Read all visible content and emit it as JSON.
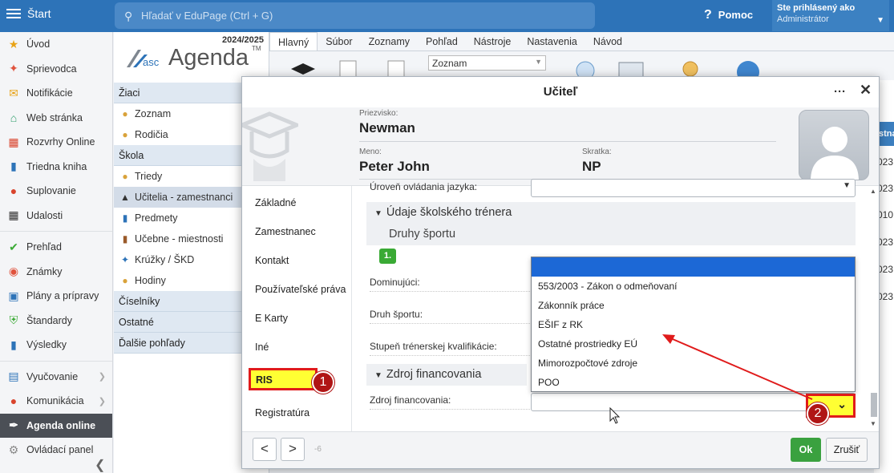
{
  "topbar": {
    "start_label": "Štart",
    "search_placeholder": "Hľadať v EduPage (Ctrl + G)",
    "help_label": "Pomoc",
    "user_line1": "Ste prihlásený ako",
    "user_line2": "Administrátor"
  },
  "leftnav": {
    "items": [
      {
        "label": "Úvod",
        "icon": "star-icon",
        "color": "#e8a317"
      },
      {
        "label": "Sprievodca",
        "icon": "wand-icon",
        "color": "#e0533d"
      },
      {
        "label": "Notifikácie",
        "icon": "envelope-icon",
        "color": "#e8a317"
      },
      {
        "label": "Web stránka",
        "icon": "home-icon",
        "color": "#2e9e6b"
      },
      {
        "label": "Rozvrhy Online",
        "icon": "grid-icon",
        "color": "#d9442d"
      },
      {
        "label": "Triedna kniha",
        "icon": "book-icon",
        "color": "#2d73b8"
      },
      {
        "label": "Suplovanie",
        "icon": "person-icon",
        "color": "#d9442d"
      },
      {
        "label": "Udalosti",
        "icon": "calendar-icon",
        "color": "#333333"
      },
      {
        "label": "Prehľad",
        "icon": "check-circle-icon",
        "color": "#3aaa35"
      },
      {
        "label": "Známky",
        "icon": "grade-icon",
        "color": "#e0533d"
      },
      {
        "label": "Plány a prípravy",
        "icon": "briefcase-icon",
        "color": "#2d73b8"
      },
      {
        "label": "Štandardy",
        "icon": "shield-icon",
        "color": "#3aaa35"
      },
      {
        "label": "Výsledky",
        "icon": "bar-chart-icon",
        "color": "#2d73b8"
      },
      {
        "label": "Vyučovanie",
        "icon": "board-icon",
        "color": "#2d73b8"
      },
      {
        "label": "Komunikácia",
        "icon": "chat-icon",
        "color": "#d9442d"
      },
      {
        "label": "Agenda online",
        "icon": "agenda-icon",
        "color": "#ffffff"
      },
      {
        "label": "Ovládací panel",
        "icon": "gear-icon",
        "color": "#888888"
      }
    ]
  },
  "agenda": {
    "year": "2024/2025",
    "logo_asc": "asc",
    "logo_name": "Agenda",
    "logo_tm": "TM",
    "sections": {
      "ziaci": "Žiaci",
      "zoznam": "Zoznam",
      "rodicia": "Rodičia",
      "skola": "Škola",
      "triedy": "Triedy",
      "ucitelia": "Učitelia - zamestnanci",
      "predmety": "Predmety",
      "ucebne": "Učebne - miestnosti",
      "kruzky": "Krúžky / ŠKD",
      "hodiny": "Hodiny",
      "ciselniky": "Číselníky",
      "ostatne": "Ostatné",
      "dalsie": "Ďalšie pohľady"
    }
  },
  "ribbon": {
    "tabs": [
      "Hlavný",
      "Súbor",
      "Zoznamy",
      "Pohľad",
      "Nástroje",
      "Nastavenia",
      "Návod"
    ],
    "select_value": "Zoznam"
  },
  "rstrip": {
    "header": "stna",
    "rows": [
      "023",
      "023",
      "010",
      "023",
      "023",
      "023"
    ]
  },
  "dialog": {
    "title": "Učiteľ",
    "more": "···",
    "close": "✕",
    "priezvisko_label": "Priezvisko:",
    "priezvisko": "Newman",
    "meno_label": "Meno:",
    "meno": "Peter John",
    "skratka_label": "Skratka:",
    "skratka": "NP",
    "menu": [
      "Základné",
      "Zamestnanec",
      "Kontakt",
      "Používateľské práva",
      "E Karty",
      "Iné",
      "RIS",
      "Registratúra"
    ],
    "fields": {
      "uroven": "Úroveň ovládania jazyka:",
      "trener_head": "Údaje školského trénera",
      "druhy_sportu": "Druhy športu",
      "num": "1.",
      "dominujuci": "Dominujúci:",
      "druh_sportu": "Druh športu:",
      "stupen": "Stupeň trénerskej kvalifikácie:",
      "zdroj_head": "Zdroj financovania",
      "zdroj": "Zdroj financovania:"
    },
    "dropdown_options": [
      "553/2003 - Zákon o odmeňovaní",
      "Zákonník práce",
      "EŠIF z RK",
      "Ostatné prostriedky EÚ",
      "Mimorozpočtové zdroje",
      "POO"
    ],
    "footer": {
      "prev": "<",
      "next": ">",
      "counter": "-6",
      "ok": "Ok",
      "cancel": "Zrušiť"
    }
  },
  "annotations": {
    "badge1": "1",
    "badge2": "2",
    "highlight_color": "#ffff33",
    "border_color": "#e01b1b"
  }
}
